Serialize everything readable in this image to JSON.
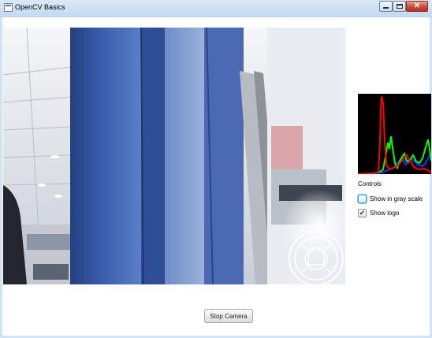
{
  "window": {
    "title": "OpenCV Basics",
    "icon": "app-window-icon"
  },
  "window_controls": {
    "minimize": "minimize-icon",
    "maximize": "maximize-icon",
    "close": "close-icon"
  },
  "controls": {
    "heading": "Controls",
    "gray_scale": {
      "label": "Show in gray scale",
      "checked": false
    },
    "show_logo": {
      "label": "Show logo",
      "checked": true
    }
  },
  "stop_button": {
    "label": "Stop Camera"
  },
  "colors": {
    "hist_red": "#ff0000",
    "hist_green": "#00ff00",
    "hist_blue": "#2233ff",
    "hist_bg": "#000000"
  }
}
